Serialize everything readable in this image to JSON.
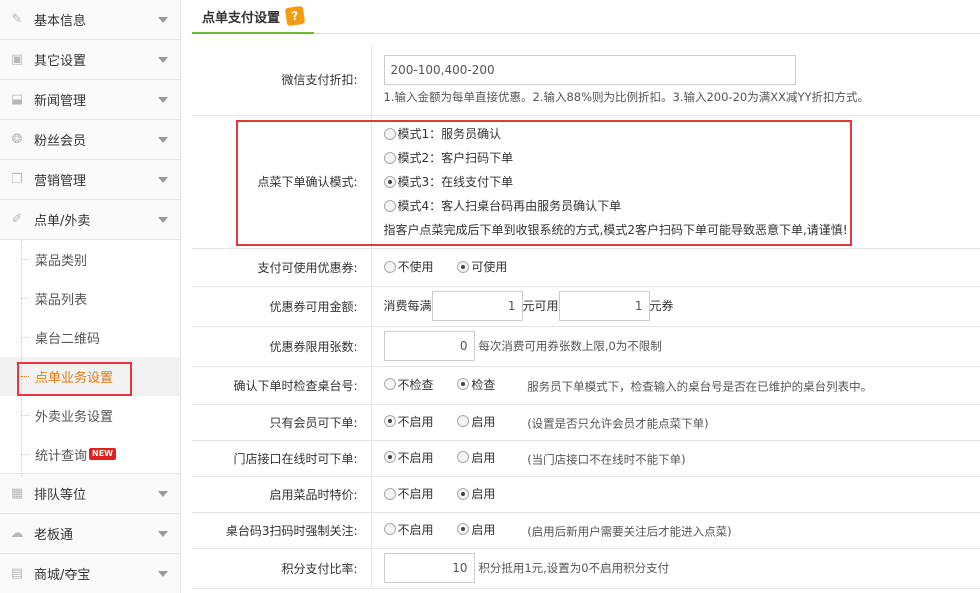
{
  "sidebar": {
    "items": [
      {
        "label": "基本信息",
        "icon": "pencil-icon"
      },
      {
        "label": "其它设置",
        "icon": "image-icon"
      },
      {
        "label": "新闻管理",
        "icon": "inbox-icon"
      },
      {
        "label": "粉丝会员",
        "icon": "lifebuoy-icon"
      },
      {
        "label": "营销管理",
        "icon": "cube-icon"
      },
      {
        "label": "点单/外卖",
        "icon": "brush-icon"
      }
    ],
    "sub_items": [
      {
        "label": "菜品类别"
      },
      {
        "label": "菜品列表"
      },
      {
        "label": "桌台二维码"
      },
      {
        "label": "点单业务设置"
      },
      {
        "label": "外卖业务设置"
      },
      {
        "label": "统计查询"
      }
    ],
    "new_badge": "NEW",
    "bottom_items": [
      {
        "label": "排队等位",
        "icon": "calendar-icon"
      },
      {
        "label": "老板通",
        "icon": "cloud-icon"
      },
      {
        "label": "商城/夺宝",
        "icon": "grid-icon"
      }
    ]
  },
  "tab": {
    "title": "点单支付设置",
    "help": "?"
  },
  "form": {
    "wechat_discount": {
      "label": "微信支付折扣:",
      "value": "200-100,400-200",
      "hint": "1.输入金额为每单直接优惠。2.输入88%则为比例折扣。3.输入200-20为满XX减YY折扣方式。"
    },
    "confirm_mode": {
      "label": "点菜下单确认模式:",
      "options": [
        {
          "label": "模式1：服务员确认",
          "checked": false
        },
        {
          "label": "模式2：客户扫码下单",
          "checked": false
        },
        {
          "label": "模式3：在线支付下单",
          "checked": true
        },
        {
          "label": "模式4：客人扫桌台码再由服务员确认下单",
          "checked": false
        }
      ],
      "note": "指客户点菜完成后下单到收银系统的方式,模式2客户扫码下单可能导致恶意下单,请谨慎!"
    },
    "coupon_usable": {
      "label": "支付可使用优惠券:",
      "options": [
        {
          "label": "不使用",
          "checked": false
        },
        {
          "label": "可使用",
          "checked": true
        }
      ]
    },
    "coupon_amount": {
      "label": "优惠券可用金额:",
      "prefix": "消费每满",
      "value1": "1",
      "middle": "元可用",
      "value2": "1",
      "suffix": "元券"
    },
    "coupon_limit": {
      "label": "优惠券限用张数:",
      "value": "0",
      "hint": "每次消费可用券张数上限,0为不限制"
    },
    "check_table": {
      "label": "确认下单时检查桌台号:",
      "options": [
        {
          "label": "不检查",
          "checked": false
        },
        {
          "label": "检查",
          "checked": true
        }
      ],
      "hint": "服务员下单模式下，检查输入的桌台号是否在已维护的桌台列表中。"
    },
    "member_only": {
      "label": "只有会员可下单:",
      "options": [
        {
          "label": "不启用",
          "checked": true
        },
        {
          "label": "启用",
          "checked": false
        }
      ],
      "hint": "(设置是否只允许会员才能点菜下单)"
    },
    "store_online": {
      "label": "门店接口在线时可下单:",
      "options": [
        {
          "label": "不启用",
          "checked": true
        },
        {
          "label": "启用",
          "checked": false
        }
      ],
      "hint": "(当门店接口不在线时不能下单)"
    },
    "special_price": {
      "label": "启用菜品时特价:",
      "options": [
        {
          "label": "不启用",
          "checked": false
        },
        {
          "label": "启用",
          "checked": true
        }
      ]
    },
    "force_follow": {
      "label": "桌台码3扫码时强制关注:",
      "options": [
        {
          "label": "不启用",
          "checked": false
        },
        {
          "label": "启用",
          "checked": true
        }
      ],
      "hint": "(启用后新用户需要关注后才能进入点菜)"
    },
    "points_ratio": {
      "label": "积分支付比率:",
      "value": "10",
      "hint": "积分抵用1元,设置为0不启用积分支付"
    }
  },
  "colors": {
    "accent_green": "#73b53a",
    "highlight_red": "#e3393c",
    "active_orange": "#e27b0b"
  }
}
